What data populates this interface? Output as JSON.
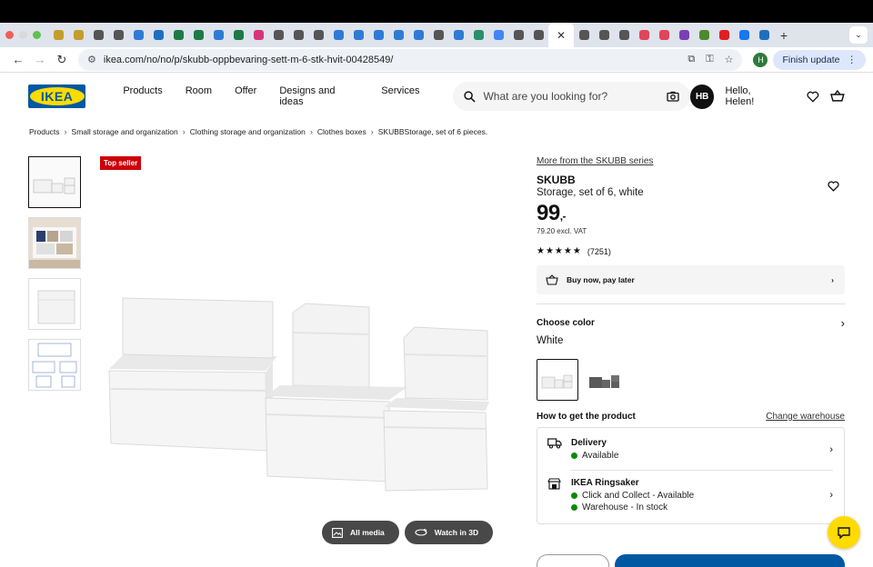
{
  "browser": {
    "url": "ikea.com/no/no/p/skubb-oppbevaring-sett-m-6-stk-hvit-00428549/",
    "finish_update": "Finish update",
    "profile_initial": "H",
    "tab_icon_colors": [
      "#c59d2b",
      "#c59d2b",
      "#555",
      "#555",
      "#2e7bd6",
      "#1e6fbf",
      "#1d7a44",
      "#1d7a44",
      "#2e7bd6",
      "#1d7a44",
      "#d6337a",
      "#555",
      "#555",
      "#555",
      "#2e7bd6",
      "#2e7bd6",
      "#2e7bd6",
      "#2e7bd6",
      "#2e7bd6",
      "#555",
      "#2e7bd6",
      "#2a8f6a",
      "#4285f4",
      "#555",
      "#555"
    ],
    "tab_icon_colors_right": [
      "#555",
      "#555",
      "#555",
      "#e0455b",
      "#e0455b",
      "#7b3fb5",
      "#4a8b2e",
      "#e02020",
      "#1877f2",
      "#1e6fbf"
    ]
  },
  "header": {
    "nav": [
      "Products",
      "Room",
      "Offer",
      "Designs and ideas",
      "Services"
    ],
    "search_placeholder": "What are you looking for?",
    "avatar_initials": "HB",
    "greeting": "Hello, Helen!"
  },
  "breadcrumb": [
    "Products",
    "Small storage and organization",
    "Clothing storage and organization",
    "Clothes boxes",
    "SKUBBStorage, set of 6 pieces."
  ],
  "gallery": {
    "badge": "Top seller",
    "all_media": "All media",
    "watch_3d": "Watch in 3D"
  },
  "product": {
    "series_link": "More from the SKUBB series",
    "name": "SKUBB",
    "description": "Storage, set of 6, white",
    "price": "99",
    "price_suffix": ",-",
    "excl_vat": "79.20 excl. VAT",
    "stars": "★★★★★",
    "review_count": "(7251)",
    "bnpl": "Buy now, pay later",
    "choose_color": "Choose color",
    "color": "White",
    "how_to_get": "How to get the product",
    "change_warehouse": "Change warehouse",
    "delivery_title": "Delivery",
    "delivery_status": "Available",
    "store_title": "IKEA Ringsaker",
    "store_status_1": "Click and Collect - Available",
    "store_status_2": "Warehouse - In stock"
  }
}
